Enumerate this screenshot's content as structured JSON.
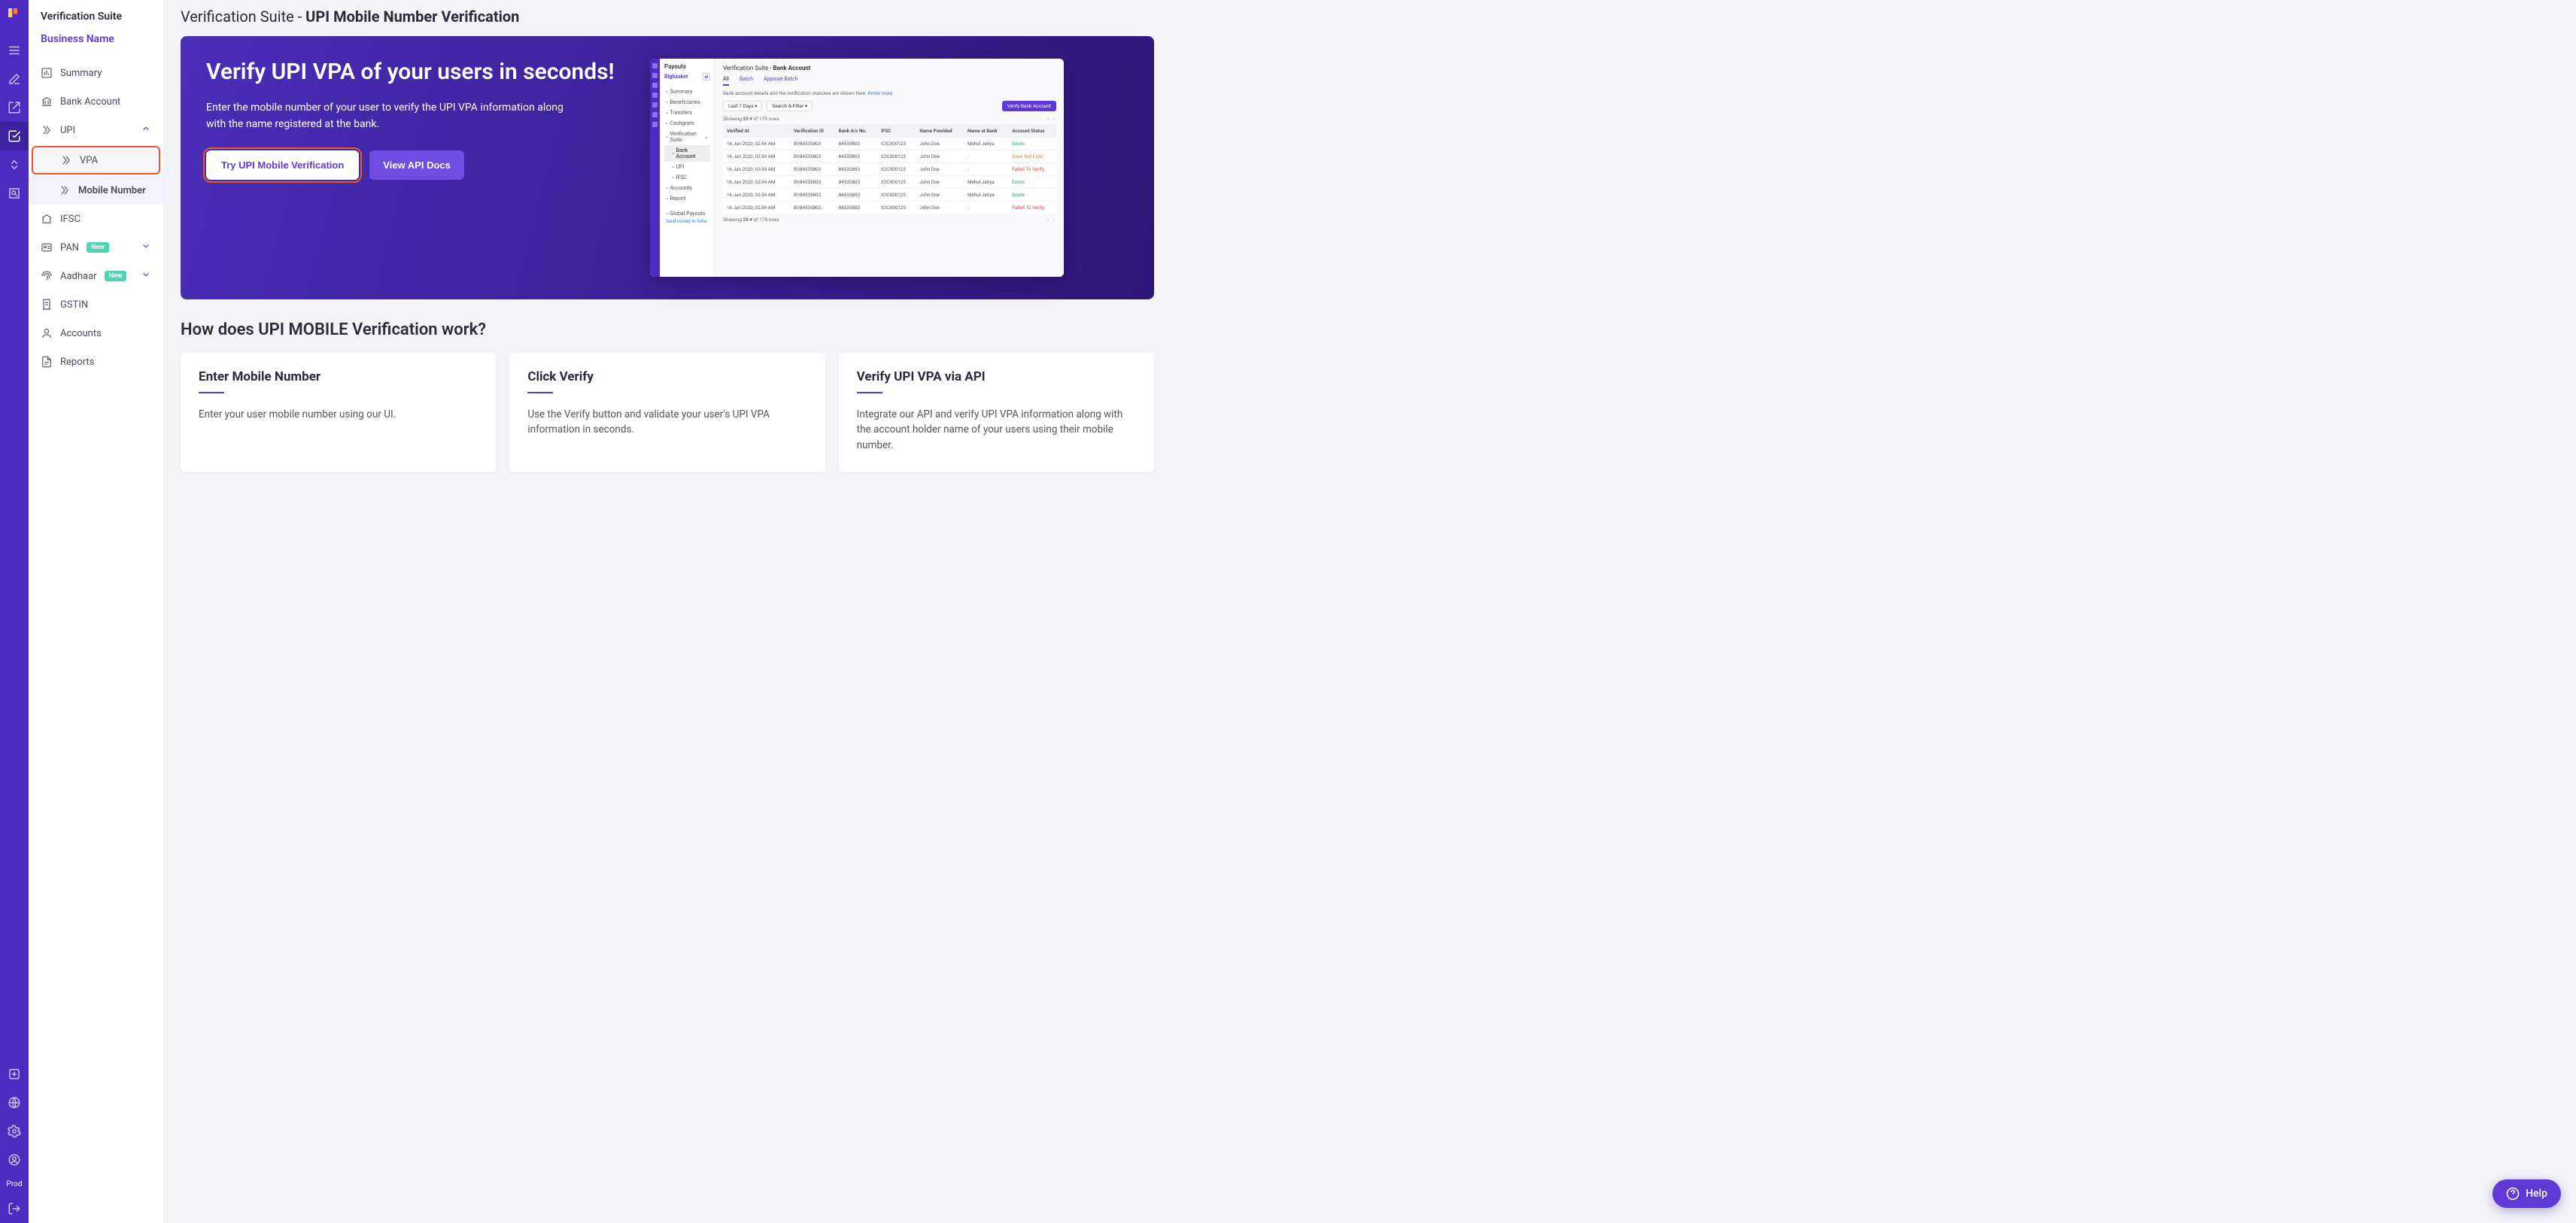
{
  "rail": {
    "prod_label": "Prod"
  },
  "sidebar": {
    "title": "Verification Suite",
    "business_name": "Business Name",
    "items": {
      "summary": "Summary",
      "bank_account": "Bank Account",
      "upi": "UPI",
      "vpa": "VPA",
      "mobile_number": "Mobile Number",
      "ifsc": "IFSC",
      "pan": "PAN",
      "aadhaar": "Aadhaar",
      "gstin": "GSTIN",
      "accounts": "Accounts",
      "reports": "Reports",
      "badge_new": "New"
    }
  },
  "header": {
    "prefix": "Verification Suite - ",
    "title": "UPI Mobile Number Verification"
  },
  "hero": {
    "heading": "Verify UPI VPA of your users in seconds!",
    "subtext": "Enter the mobile number of your user to verify the UPI VPA information along with the name registered at the bank.",
    "primary_btn": "Try UPI Mobile Verification",
    "secondary_btn": "View API Docs"
  },
  "preview": {
    "sidebar_title": "Payouts",
    "business": "Bigbasket",
    "nav": {
      "summary": "Summary",
      "beneficiaries": "Beneficiaries",
      "transfers": "Transfers",
      "cashgram": "Cashgram",
      "verification_suite": "Verification Suite",
      "bank_account": "Bank Account",
      "upi": "UPI",
      "ifsc": "IFSC",
      "accounts": "Accounts",
      "report": "Report",
      "global_payouts": "Global Payouts",
      "global_sub": "Send money to India"
    },
    "crumb_prefix": "Verification Suite - ",
    "crumb_title": "Bank Account",
    "tabs": {
      "all": "All",
      "batch": "Batch",
      "approve": "Approve Batch"
    },
    "info_text": "Bank account details and the verification statuses are shown here. ",
    "info_link": "Know more",
    "filter": {
      "range": "Last 7 Days ▾",
      "search": "Search & Filter ▾",
      "verify_btn": "Verify Bank Account"
    },
    "showing": {
      "label_a": "Showing",
      "count": "25 ▾",
      "label_b": "of 175 rows"
    },
    "columns": [
      "Verified At",
      "Verification ID",
      "Bank A/c No.",
      "IFSC",
      "Name Provided",
      "Name at Bank",
      "Account Status"
    ],
    "rows": [
      {
        "at": "16 Jan 2020, 02:54 AM",
        "vid": "BV84535803",
        "acc": "84535803",
        "ifsc": "ICIC000123",
        "np": "John Doe",
        "nb": "Mehul Jatiya",
        "st": "Exists",
        "cls": "st-ex"
      },
      {
        "at": "16 Jan 2020, 02:54 AM",
        "vid": "BV84535803",
        "acc": "84535803",
        "ifsc": "ICIC000123",
        "np": "John Doe",
        "nb": "-",
        "st": "Does Not Exist",
        "cls": "st-dne"
      },
      {
        "at": "16 Jan 2020, 02:54 AM",
        "vid": "BV84535803",
        "acc": "84535803",
        "ifsc": "ICIC000123",
        "np": "John Doe",
        "nb": "-",
        "st": "Failed To Verify",
        "cls": "st-fv"
      },
      {
        "at": "16 Jan 2020, 02:54 AM",
        "vid": "BV84535803",
        "acc": "84535803",
        "ifsc": "ICIC000123",
        "np": "John Doe",
        "nb": "Mehul Jatiya",
        "st": "Exists",
        "cls": "st-ex"
      },
      {
        "at": "16 Jan 2020, 02:54 AM",
        "vid": "BV84535803",
        "acc": "84535803",
        "ifsc": "ICIC000123",
        "np": "John Doe",
        "nb": "Mehul Jatiya",
        "st": "Exists",
        "cls": "st-ex"
      },
      {
        "at": "16 Jan 2020, 02:54 AM",
        "vid": "BV84535803",
        "acc": "84535803",
        "ifsc": "ICIC000123",
        "np": "John Doe",
        "nb": "-",
        "st": "Failed To Verify",
        "cls": "st-fv"
      }
    ]
  },
  "section": {
    "heading": "How does UPI MOBILE Verification work?",
    "cards": [
      {
        "title": "Enter Mobile Number",
        "body": "Enter your user mobile number using our UI."
      },
      {
        "title": "Click Verify",
        "body": "Use the Verify button and validate your user's UPI VPA information in seconds."
      },
      {
        "title": "Verify UPI VPA via API",
        "body": "Integrate our API and verify UPI VPA information along with the account holder name of your users using their mobile number."
      }
    ]
  },
  "help": {
    "label": "Help"
  }
}
